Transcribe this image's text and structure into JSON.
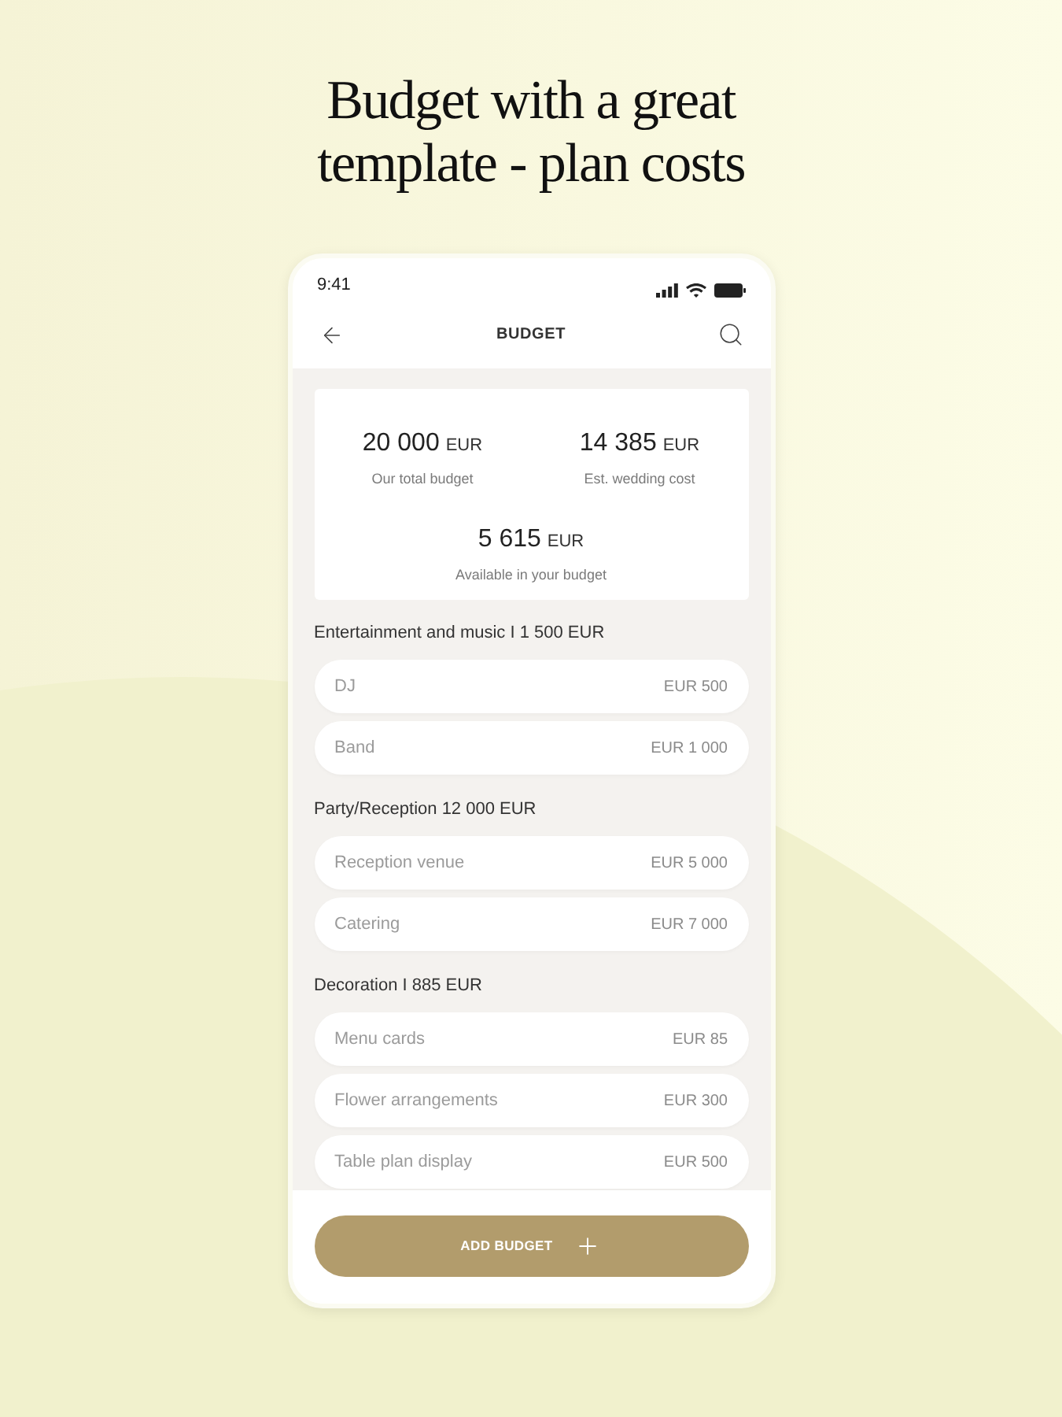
{
  "headline": [
    "Budget with a great",
    "template - plan costs"
  ],
  "status_bar": {
    "time": "9:41"
  },
  "header": {
    "title": "BUDGET"
  },
  "summary": {
    "totals": [
      {
        "amount": "20 000",
        "currency": "EUR",
        "label": "Our total budget"
      },
      {
        "amount": "14 385",
        "currency": "EUR",
        "label": "Est. wedding cost"
      }
    ],
    "available": {
      "amount": "5 615",
      "currency": "EUR",
      "label": "Available in your budget"
    }
  },
  "sections": [
    {
      "title": "Entertainment and music I 1 500 EUR",
      "items": [
        {
          "name": "DJ",
          "amount": "EUR 500"
        },
        {
          "name": "Band",
          "amount": "EUR 1 000"
        }
      ]
    },
    {
      "title": "Party/Reception 12 000 EUR",
      "items": [
        {
          "name": "Reception venue",
          "amount": "EUR 5 000"
        },
        {
          "name": "Catering",
          "amount": "EUR 7 000"
        }
      ]
    },
    {
      "title": "Decoration I 885 EUR",
      "items": [
        {
          "name": "Menu cards",
          "amount": "EUR 85"
        },
        {
          "name": "Flower arrangements",
          "amount": "EUR 300"
        },
        {
          "name": "Table plan display",
          "amount": "EUR 500"
        }
      ]
    }
  ],
  "action_button": {
    "label": "ADD BUDGET"
  }
}
